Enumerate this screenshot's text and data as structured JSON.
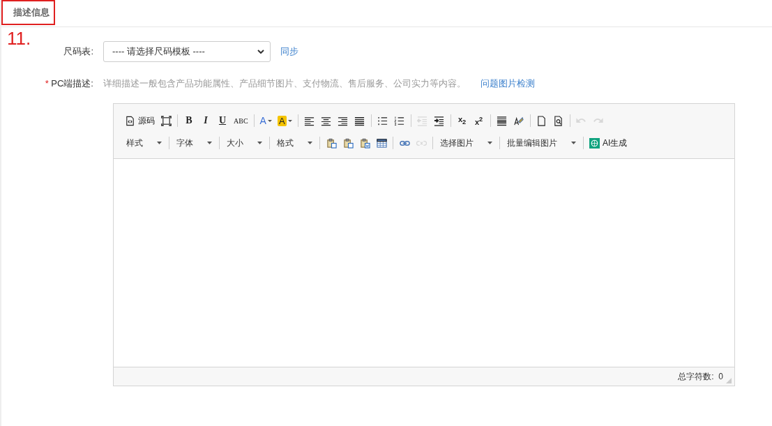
{
  "tabs": [
    {
      "label": "描述信息",
      "selected": true
    }
  ],
  "annotation": "11.",
  "size_chart": {
    "label": "尺码表:",
    "placeholder": "---- 请选择尺码模板 ----",
    "link": "同步"
  },
  "pc_description": {
    "required_mark": "*",
    "label": "PC端描述:",
    "hint": "详细描述一般包含产品功能属性、产品细节图片、支付物流、售后服务、公司实力等内容。",
    "link": "问题图片检测"
  },
  "editor": {
    "toolbar_rows": [
      [
        {
          "kind": "source",
          "label": "源码",
          "disabled": false
        },
        {
          "kind": "fullscreen",
          "disabled": false
        },
        {
          "kind": "separator"
        },
        {
          "kind": "bold",
          "glyph": "B",
          "disabled": false
        },
        {
          "kind": "italic",
          "glyph": "I",
          "disabled": false
        },
        {
          "kind": "underline",
          "glyph": "U",
          "disabled": false
        },
        {
          "kind": "strike",
          "glyph": "ABC",
          "disabled": false
        },
        {
          "kind": "separator"
        },
        {
          "kind": "forecolor",
          "glyph": "A",
          "disabled": false
        },
        {
          "kind": "backcolor",
          "glyph": "A",
          "disabled": false
        },
        {
          "kind": "separator"
        },
        {
          "kind": "align-left",
          "disabled": false
        },
        {
          "kind": "align-center",
          "disabled": false
        },
        {
          "kind": "align-right",
          "disabled": false
        },
        {
          "kind": "justify",
          "disabled": false
        },
        {
          "kind": "separator"
        },
        {
          "kind": "ul",
          "disabled": false
        },
        {
          "kind": "ol",
          "disabled": false
        },
        {
          "kind": "separator"
        },
        {
          "kind": "outdent",
          "disabled": true
        },
        {
          "kind": "indent",
          "disabled": false
        },
        {
          "kind": "separator"
        },
        {
          "kind": "subscript",
          "glyph": "x$_{2}$",
          "disabled": false
        },
        {
          "kind": "superscript",
          "glyph": "x$^{2}$",
          "disabled": false
        },
        {
          "kind": "separator"
        },
        {
          "kind": "hr",
          "disabled": false
        },
        {
          "kind": "format-painter",
          "disabled": false
        },
        {
          "kind": "separator"
        },
        {
          "kind": "new-doc",
          "disabled": false
        },
        {
          "kind": "preview",
          "disabled": false
        },
        {
          "kind": "separator"
        },
        {
          "kind": "undo",
          "disabled": true
        },
        {
          "kind": "redo",
          "disabled": true
        }
      ],
      [
        {
          "kind": "dropdown",
          "label": "样式",
          "disabled": false
        },
        {
          "kind": "separator"
        },
        {
          "kind": "dropdown",
          "label": "字体",
          "disabled": false
        },
        {
          "kind": "separator"
        },
        {
          "kind": "dropdown",
          "label": "大小",
          "disabled": false
        },
        {
          "kind": "separator"
        },
        {
          "kind": "dropdown",
          "label": "格式",
          "disabled": false
        },
        {
          "kind": "separator"
        },
        {
          "kind": "paste",
          "disabled": false
        },
        {
          "kind": "paste-text",
          "disabled": false
        },
        {
          "kind": "paste-word",
          "disabled": false
        },
        {
          "kind": "table",
          "disabled": false
        },
        {
          "kind": "separator"
        },
        {
          "kind": "link",
          "disabled": false
        },
        {
          "kind": "unlink",
          "disabled": true
        },
        {
          "kind": "separator"
        },
        {
          "kind": "dropdown",
          "label": "选择图片",
          "disabled": false
        },
        {
          "kind": "separator"
        },
        {
          "kind": "dropdown",
          "label": "批量编辑图片",
          "disabled": false
        },
        {
          "kind": "separator"
        },
        {
          "kind": "ai",
          "label": "AI生成",
          "disabled": false
        }
      ]
    ],
    "status": {
      "label": "总字符数:",
      "count": "0"
    }
  }
}
